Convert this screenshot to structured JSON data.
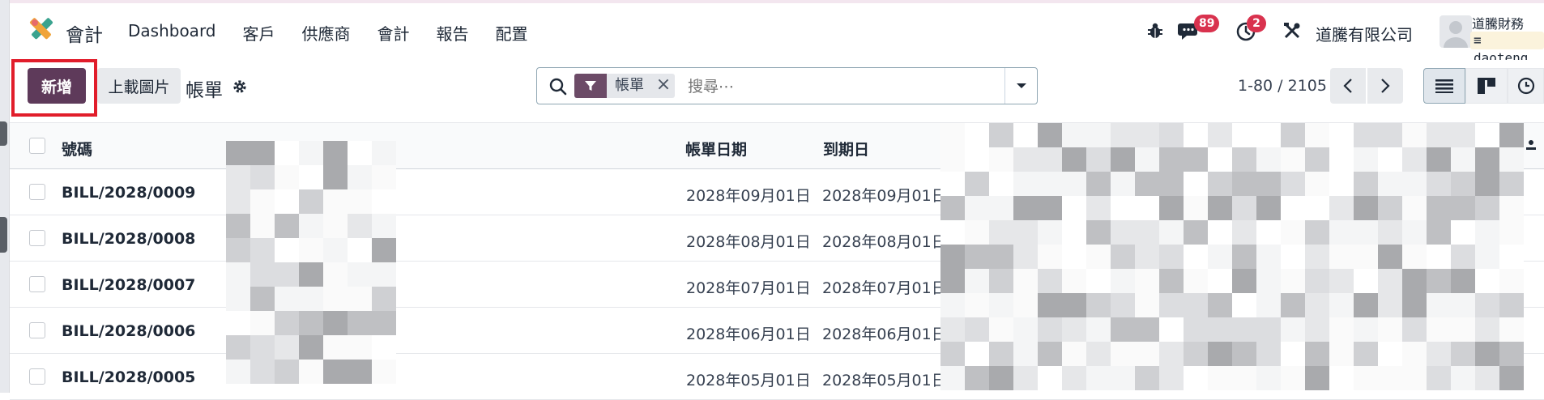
{
  "app": {
    "name": "會計"
  },
  "menu": [
    "Dashboard",
    "客戶",
    "供應商",
    "會計",
    "報告",
    "配置"
  ],
  "systray": {
    "bug_icon": "bug-icon",
    "messages_count": "89",
    "activities_count": "2",
    "settings_icon": "tools-icon",
    "company": "道騰有限公司",
    "user_name": "道騰財務",
    "database": "daoteng"
  },
  "control_panel": {
    "new_label": "新增",
    "upload_label": "上載圖片",
    "breadcrumb": "帳單",
    "search": {
      "facet": "帳單",
      "placeholder": "搜尋⋯"
    },
    "pager": "1-80 / 2105"
  },
  "table": {
    "headers": {
      "number": "號碼",
      "bill_date": "帳單日期",
      "due_date": "到期日"
    },
    "rows": [
      {
        "number": "BILL/2028/0009",
        "bill_date": "2028年09月01日",
        "due_date": "2028年09月01日"
      },
      {
        "number": "BILL/2028/0008",
        "bill_date": "2028年08月01日",
        "due_date": "2028年08月01日"
      },
      {
        "number": "BILL/2028/0007",
        "bill_date": "2028年07月01日",
        "due_date": "2028年07月01日"
      },
      {
        "number": "BILL/2028/0006",
        "bill_date": "2028年06月01日",
        "due_date": "2028年06月01日"
      },
      {
        "number": "BILL/2028/0005",
        "bill_date": "2028年05月01日",
        "due_date": "2028年05月01日"
      }
    ]
  },
  "colors": {
    "primary": "#5e3a5a",
    "badge": "#d9324e",
    "highlight": "#e11d2b"
  }
}
